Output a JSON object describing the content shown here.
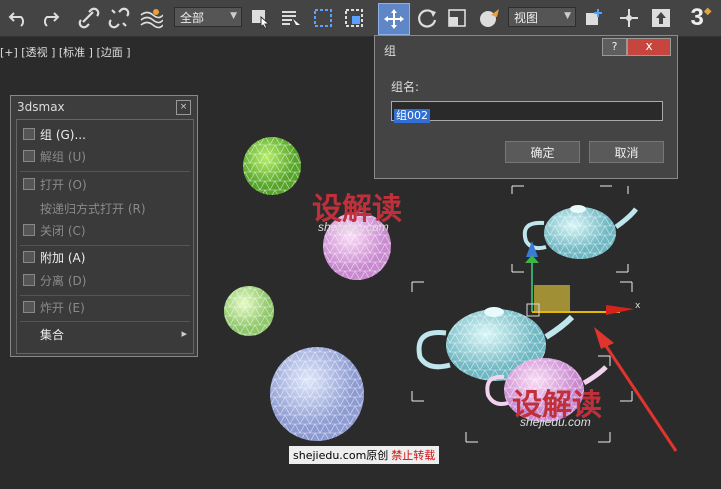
{
  "toolbar": {
    "selection_filter": "全部",
    "ref_coord": "视图",
    "snap_toggle": "3"
  },
  "viewport": {
    "label": "[+] [透视 ] [标准 ] [边面 ]"
  },
  "quad_panel": {
    "title": "3dsmax",
    "items": [
      {
        "label": "组 (G)...",
        "enabled": true
      },
      {
        "label": "解组 (U)",
        "enabled": false
      },
      {
        "label": "打开 (O)",
        "enabled": false
      },
      {
        "label": "按递归方式打开 (R)",
        "enabled": false
      },
      {
        "label": "关闭 (C)",
        "enabled": false
      },
      {
        "label": "附加 (A)",
        "enabled": true
      },
      {
        "label": "分离 (D)",
        "enabled": false
      },
      {
        "label": "炸开 (E)",
        "enabled": false
      },
      {
        "label": "集合",
        "enabled": true
      }
    ],
    "submenu_arrow": "▸"
  },
  "group_dialog": {
    "title": "组",
    "help_label": "?",
    "close_label": "x",
    "name_label": "组名:",
    "name_value": "组002",
    "ok_label": "确定",
    "cancel_label": "取消"
  },
  "watermark": {
    "brand": "设解读",
    "domain": "shejiedu.com",
    "credit_main": "shejiedu.com原创",
    "credit_warn": "禁止转载"
  },
  "gizmo": {
    "axis_x": "x"
  }
}
